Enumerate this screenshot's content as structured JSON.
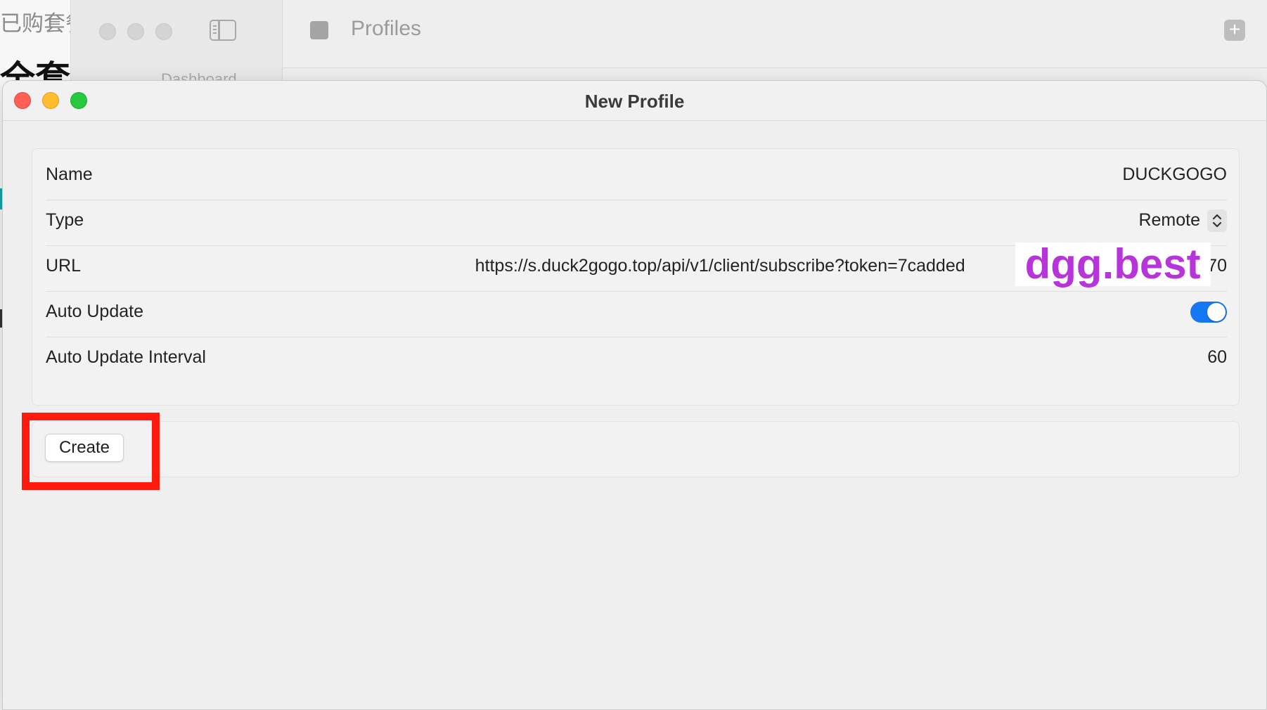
{
  "background": {
    "left_fragment_top": "已购套餐",
    "left_fragment_big": "全套",
    "main_window": {
      "sidebar_item": "Dashboard",
      "title": "Profiles",
      "add_icon": "plus-icon",
      "sidebar_toggle_icon": "sidebar-toggle-icon"
    }
  },
  "dialog": {
    "title": "New Profile",
    "traffic_lights": [
      "close",
      "minimize",
      "zoom"
    ],
    "fields": {
      "name": {
        "label": "Name",
        "value": "DUCKGOGO"
      },
      "type": {
        "label": "Type",
        "value": "Remote",
        "icon": "chevron-updown-icon"
      },
      "url": {
        "label": "URL",
        "value": "https://s.duck2gogo.top/api/v1/client/subscribe?token=7cadded",
        "value_tail": "9fb2d70"
      },
      "auto_update": {
        "label": "Auto Update",
        "enabled": true
      },
      "auto_update_interval": {
        "label": "Auto Update Interval",
        "value": "60"
      }
    },
    "create_button": "Create"
  },
  "overlay": {
    "watermark": "dgg.best",
    "watermark_color": "#b634d9",
    "highlight_color": "#ff1a0d"
  },
  "colors": {
    "toggle_on": "#1577f1",
    "close": "#fe5f57",
    "minimize": "#febc2e",
    "zoom": "#28c840"
  }
}
